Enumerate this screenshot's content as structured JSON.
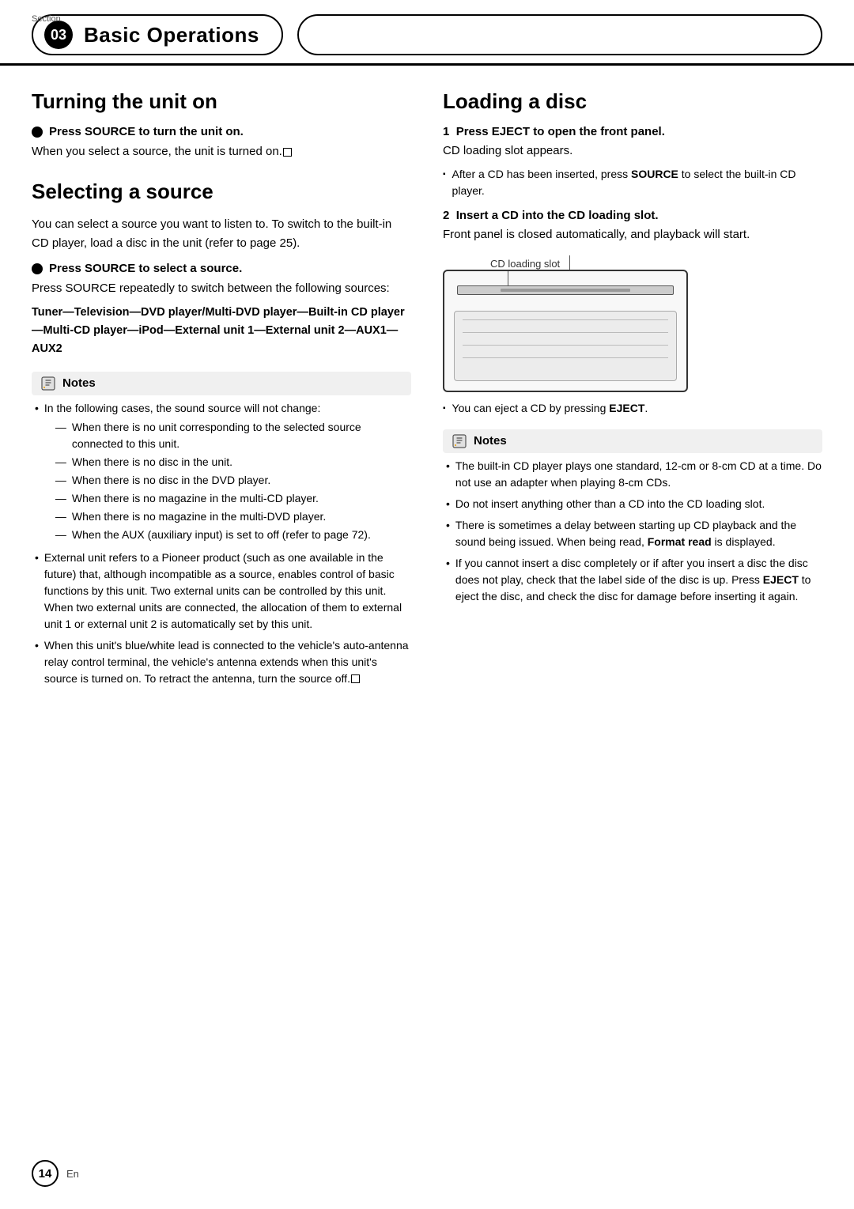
{
  "header": {
    "section_label": "Section",
    "section_number": "03",
    "section_title": "Basic Operations"
  },
  "left": {
    "turning_on": {
      "heading": "Turning the unit on",
      "bullet_heading": "Press SOURCE to turn the unit on.",
      "para1": "When you select a source, the unit is turned on."
    },
    "selecting_source": {
      "heading": "Selecting a source",
      "para1": "You can select a source you want to listen to. To switch to the built-in CD player, load a disc in the unit (refer to page 25).",
      "bullet_heading": "Press SOURCE to select a source.",
      "para2": "Press SOURCE repeatedly to switch between the following sources:",
      "sources": "Tuner—Television—DVD player/Multi-DVD player—Built-in CD player—Multi-CD player—iPod—External unit 1—External unit 2—AUX1—AUX2",
      "notes_label": "Notes",
      "notes": [
        {
          "text": "In the following cases, the sound source will not change:",
          "sub": [
            "When there is no unit corresponding to the selected source connected to this unit.",
            "When there is no disc in the unit.",
            "When there is no disc in the DVD player.",
            "When there is no magazine in the multi-CD player.",
            "When there is no magazine in the multi-DVD player.",
            "When the AUX (auxiliary input) is set to off (refer to page 72)."
          ]
        },
        {
          "text": "External unit refers to a Pioneer product (such as one available in the future) that, although incompatible as a source, enables control of basic functions by this unit. Two external units can be controlled by this unit. When two external units are connected, the allocation of them to external unit 1 or external unit 2 is automatically set by this unit.",
          "sub": []
        },
        {
          "text": "When this unit's blue/white lead is connected to the vehicle's auto-antenna relay control terminal, the vehicle's antenna extends when this unit's source is turned on. To retract the antenna, turn the source off.",
          "sub": []
        }
      ]
    }
  },
  "right": {
    "loading_disc": {
      "heading": "Loading a disc",
      "step1_num": "1",
      "step1_heading": "Press EJECT to open the front panel.",
      "step1_para": "CD loading slot appears.",
      "step1_bullet": "After a CD has been inserted, press SOURCE to select the built-in CD player.",
      "step2_num": "2",
      "step2_heading": "Insert a CD into the CD loading slot.",
      "step2_para": "Front panel is closed automatically, and playback will start.",
      "cd_loading_label": "CD loading slot",
      "eject_note": "You can eject a CD by pressing EJECT.",
      "notes_label": "Notes",
      "notes": [
        "The built-in CD player plays one standard, 12-cm or 8-cm CD at a time. Do not use an adapter when playing 8-cm CDs.",
        "Do not insert anything other than a CD into the CD loading slot.",
        "There is sometimes a delay between starting up CD playback and the sound being issued. When being read, Format read is displayed.",
        "If you cannot insert a disc completely or if after you insert a disc the disc does not play, check that the label side of the disc is up. Press EJECT to eject the disc, and check the disc for damage before inserting it again."
      ]
    }
  },
  "footer": {
    "page_number": "14",
    "lang": "En"
  }
}
